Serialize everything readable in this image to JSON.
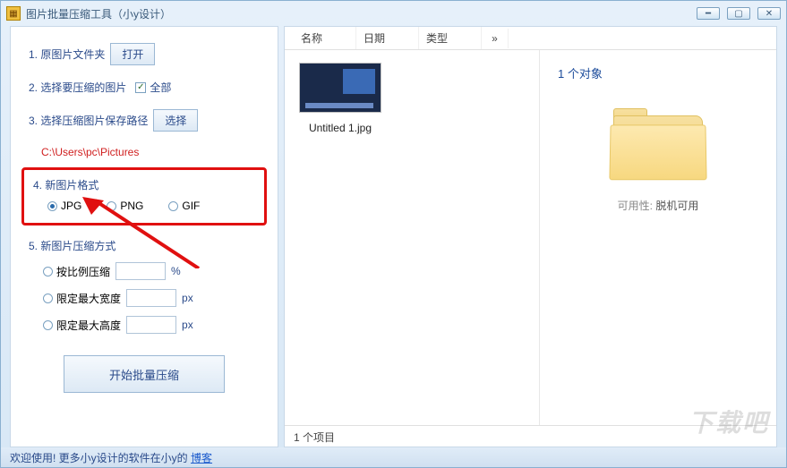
{
  "window": {
    "title": "图片批量压缩工具（小y设计）"
  },
  "left": {
    "step1_label": "1. 原图片文件夹",
    "open_btn": "打开",
    "step2_label": "2. 选择要压缩的图片",
    "all_label": "全部",
    "step3_label": "3. 选择压缩图片保存路径",
    "select_btn": "选择",
    "path": "C:\\Users\\pc\\Pictures",
    "step4_label": "4. 新图片格式",
    "fmt_jpg": "JPG",
    "fmt_png": "PNG",
    "fmt_gif": "GIF",
    "step5_label": "5. 新图片压缩方式",
    "mode_ratio": "按比例压缩",
    "mode_maxw": "限定最大宽度",
    "mode_maxh": "限定最大高度",
    "unit_percent": "%",
    "unit_px": "px",
    "start_btn": "开始批量压缩"
  },
  "right": {
    "columns": {
      "name": "名称",
      "date": "日期",
      "type": "类型",
      "more": "»"
    },
    "file_label": "Untitled 1.jpg",
    "footer_count": "1 个项目",
    "info_title": "1 个对象",
    "avail_label": "可用性:",
    "avail_value": "脱机可用"
  },
  "status": {
    "text": "欢迎使用! 更多小y设计的软件在小y的",
    "link": "博客"
  },
  "watermark": "下载吧"
}
